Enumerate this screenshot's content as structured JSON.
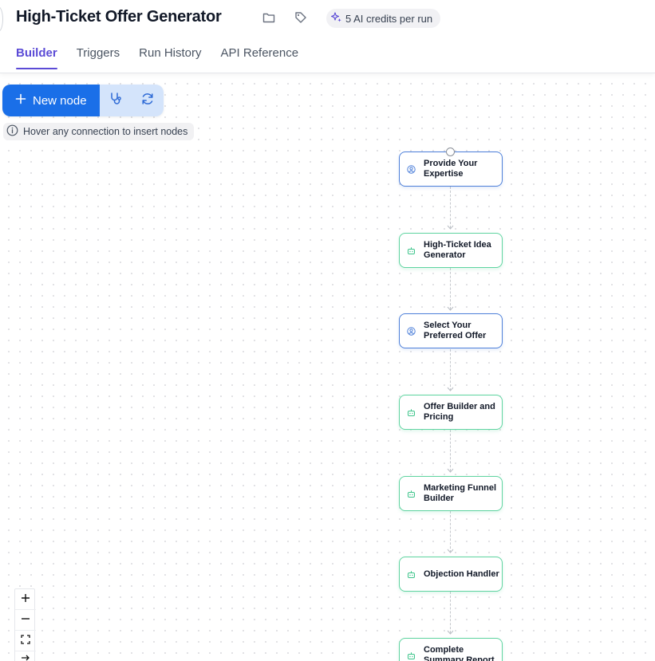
{
  "header": {
    "title": "High-Ticket Offer Generator",
    "credits_label": "5 AI credits per run",
    "icons": [
      "folder-icon",
      "tag-icon",
      "sparkles-icon"
    ]
  },
  "tabs": [
    {
      "label": "Builder",
      "active": true
    },
    {
      "label": "Triggers",
      "active": false
    },
    {
      "label": "Run History",
      "active": false
    },
    {
      "label": "API Reference",
      "active": false
    }
  ],
  "toolbar": {
    "new_node_label": "New node",
    "icons": [
      "plus-icon",
      "stethoscope-icon",
      "refresh-icon"
    ]
  },
  "hint": {
    "text": "Hover any connection to insert nodes",
    "icon": "info-icon"
  },
  "nodes": [
    {
      "label": "Provide Your Expertise",
      "kind": "input",
      "icon": "user-circle-icon"
    },
    {
      "label": "High-Ticket Idea Generator",
      "kind": "ai",
      "icon": "robot-icon"
    },
    {
      "label": "Select Your Preferred Offer",
      "kind": "input",
      "icon": "user-circle-icon"
    },
    {
      "label": "Offer Builder and Pricing",
      "kind": "ai",
      "icon": "robot-icon"
    },
    {
      "label": "Marketing Funnel Builder",
      "kind": "ai",
      "icon": "robot-icon"
    },
    {
      "label": "Objection Handler",
      "kind": "ai",
      "icon": "robot-icon"
    },
    {
      "label": "Complete Summary Report",
      "kind": "ai",
      "icon": "robot-icon"
    }
  ],
  "zoom_controls": [
    "zoom-in-icon",
    "zoom-out-icon",
    "fit-view-icon",
    "arrow-right-icon"
  ],
  "colors": {
    "accent": "#5b4bd6",
    "primary_button": "#1a6fe8",
    "input_node_border": "#4d7fd9",
    "ai_node_border": "#5fd4a0"
  }
}
